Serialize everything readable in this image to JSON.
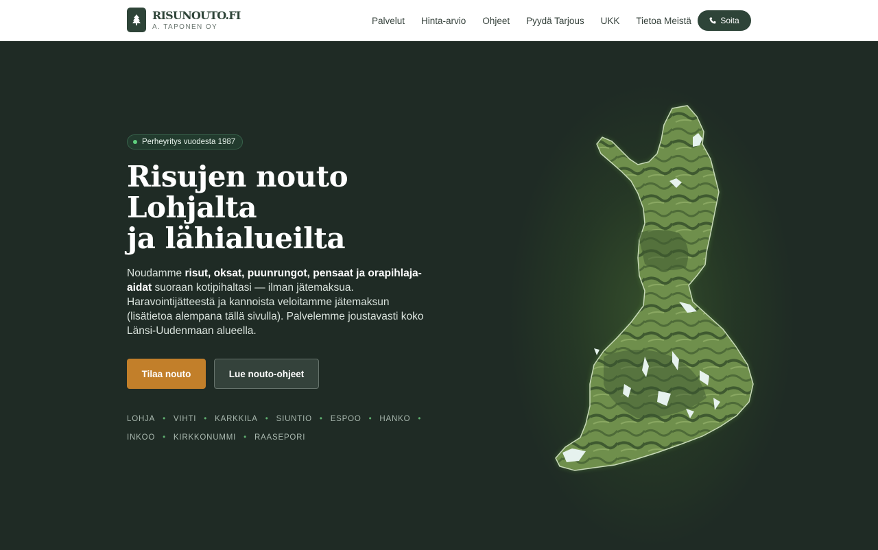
{
  "header": {
    "logo_title": "RISUNOUTO.FI",
    "logo_sub": "A. TAPONEN OY",
    "nav": [
      "Palvelut",
      "Hinta-arvio",
      "Ohjeet",
      "Pyydä Tarjous",
      "UKK",
      "Tietoa Meistä"
    ],
    "call_label": "Soita"
  },
  "hero": {
    "badge": "Perheyritys vuodesta 1987",
    "title_lines": [
      "Risujen nouto",
      "Lohjalta",
      "ja lähialueilta"
    ],
    "lead_1": "Noudamme ",
    "lead_bold": "risut, oksat, puunrungot, pensaat ja orapihlaja-aidat",
    "lead_2": " suoraan kotipihaltasi — ilman jätemaksua. Haravointijätteestä ja kannoista veloitamme jätemaksun (lisätietoa alempana tällä sivulla). Palvelemme joustavasti koko Länsi-Uudenmaan alueella.",
    "primary_button": "Tilaa nouto",
    "secondary_button": "Lue nouto-ohjeet",
    "areas": [
      "LOHJA",
      "VIHTI",
      "KARKKILA",
      "SIUNTIO",
      "ESPOO",
      "HANKO",
      "INKOO",
      "KIRKKONUMMI",
      "RAASEPORI"
    ]
  },
  "colors": {
    "accent": "#c27f2a",
    "brand": "#2e4438",
    "background": "#1f2b25"
  }
}
